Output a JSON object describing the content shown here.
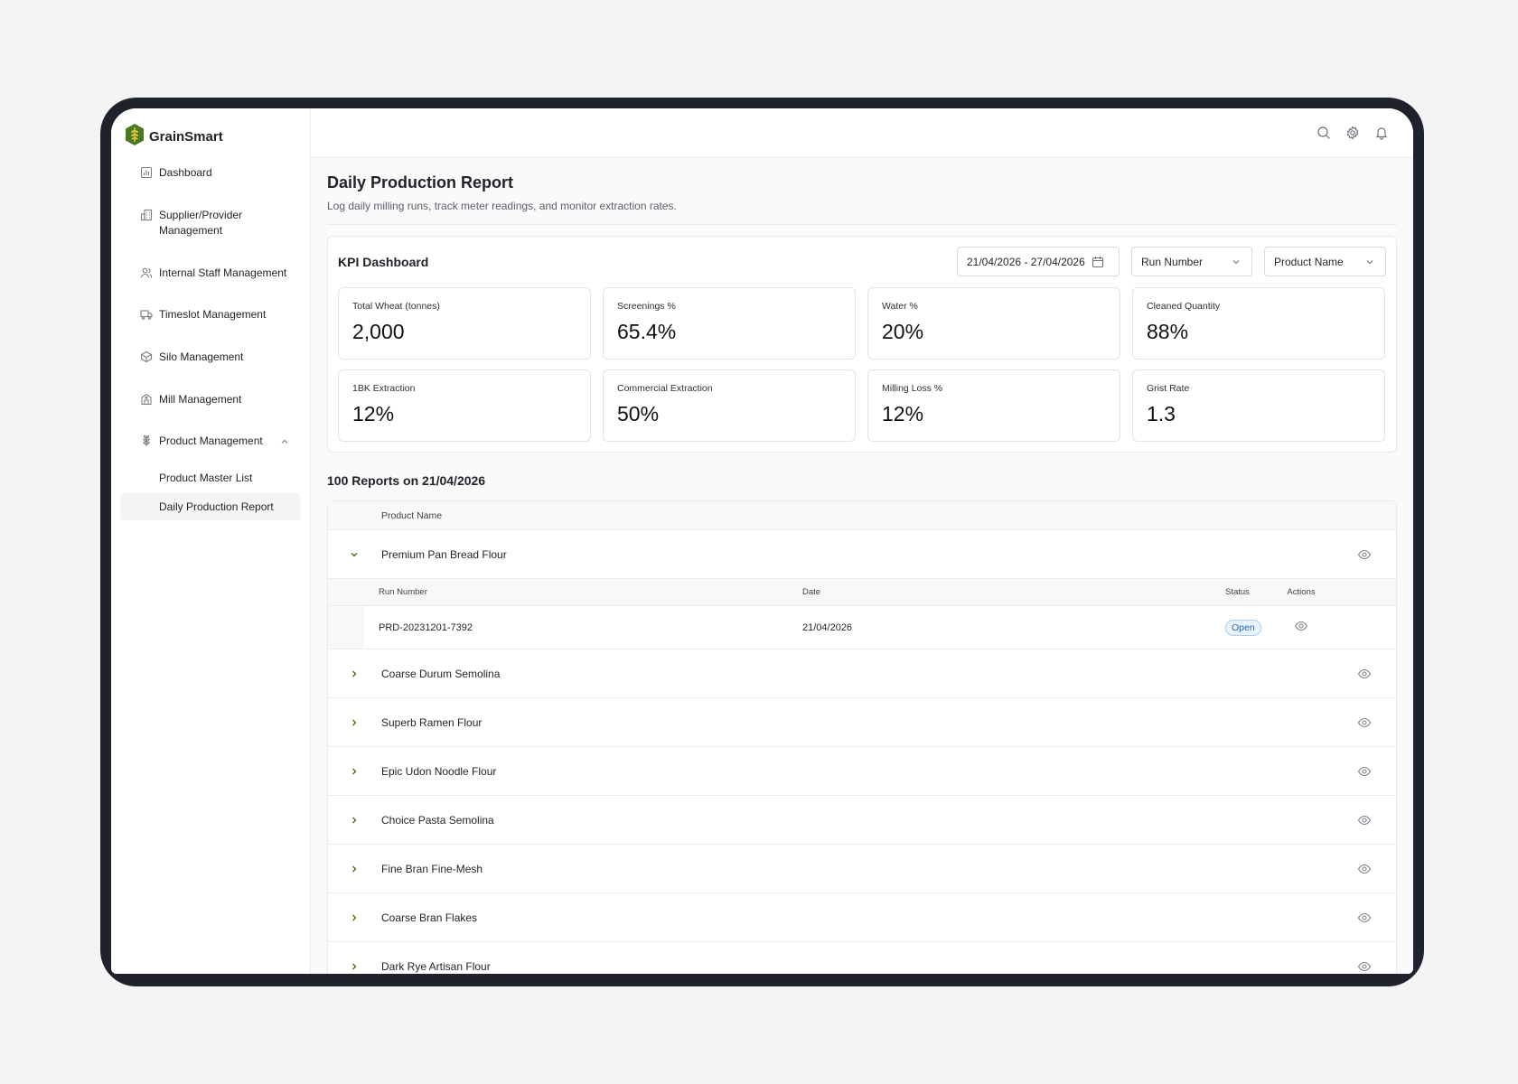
{
  "app": {
    "name": "GrainSmart"
  },
  "sidebar": {
    "items": [
      {
        "label": "Dashboard",
        "icon": "dashboard-icon"
      },
      {
        "label": "Supplier/Provider Management",
        "icon": "building-icon"
      },
      {
        "label": "Internal Staff Management",
        "icon": "users-icon"
      },
      {
        "label": "Timeslot Management",
        "icon": "truck-icon"
      },
      {
        "label": "Silo Management",
        "icon": "box-icon"
      },
      {
        "label": "Mill Management",
        "icon": "mill-icon"
      },
      {
        "label": "Product Management",
        "icon": "wheat-icon",
        "expanded": true
      }
    ],
    "sub_items": [
      {
        "label": "Product Master List"
      },
      {
        "label": "Daily Production Report",
        "active": true
      }
    ]
  },
  "topbar": {
    "icons": [
      "search-icon",
      "gear-icon",
      "bell-icon"
    ]
  },
  "page": {
    "title": "Daily Production Report",
    "subtitle": "Log daily milling runs, track meter readings, and monitor extraction rates."
  },
  "kpi": {
    "title": "KPI Dashboard",
    "filters": {
      "date_range": "21/04/2026 - 27/04/2026",
      "run_number": "Run Number",
      "product_name": "Product Name"
    },
    "cards": [
      {
        "label": "Total Wheat (tonnes)",
        "value": "2,000"
      },
      {
        "label": "Screenings %",
        "value": "65.4%"
      },
      {
        "label": "Water %",
        "value": "20%"
      },
      {
        "label": "Cleaned Quantity",
        "value": "88%"
      },
      {
        "label": "1BK Extraction",
        "value": "12%"
      },
      {
        "label": "Commercial Extraction",
        "value": "50%"
      },
      {
        "label": "Milling Loss %",
        "value": "12%"
      },
      {
        "label": "Grist Rate",
        "value": "1.3"
      }
    ]
  },
  "reports": {
    "title": "100 Reports on 21/04/2026",
    "column": "Product Name",
    "sub_columns": {
      "run": "Run Number",
      "date": "Date",
      "status": "Status",
      "actions": "Actions"
    },
    "expanded": {
      "product": "Premium Pan Bread Flour",
      "run": "PRD-20231201-7392",
      "date": "21/04/2026",
      "status": "Open"
    },
    "products": [
      "Coarse Durum Semolina",
      "Superb Ramen Flour",
      "Epic Udon Noodle Flour",
      "Choice Pasta Semolina",
      "Fine Bran Fine-Mesh",
      "Coarse Bran Flakes",
      "Dark Rye Artisan Flour"
    ]
  },
  "colors": {
    "accent_green": "#3f6a1a",
    "status_open": "#2165a8",
    "frame": "#1e222b"
  }
}
